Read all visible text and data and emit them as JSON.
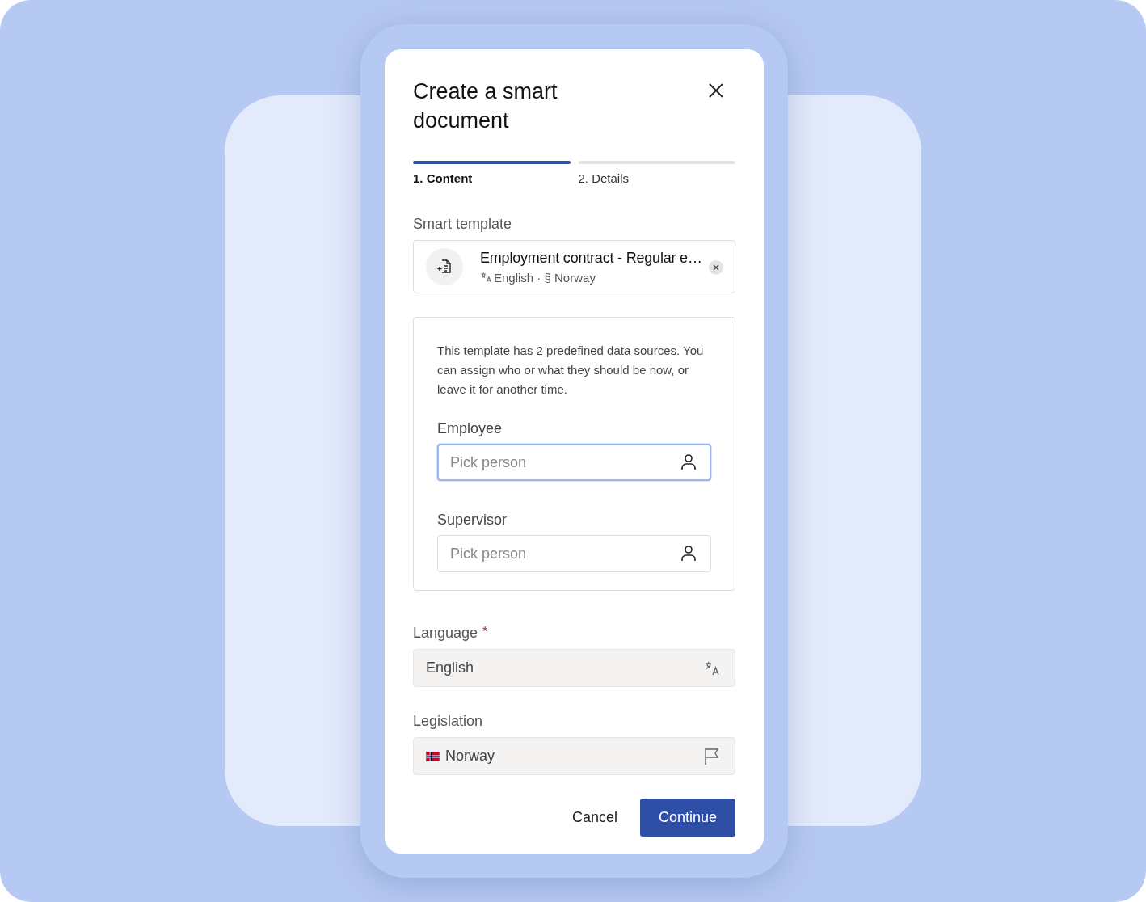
{
  "dialog": {
    "title": "Create a smart document"
  },
  "steps": [
    {
      "label": "1. Content",
      "selected": true
    },
    {
      "label": "2. Details",
      "selected": false
    }
  ],
  "smart_template": {
    "label": "Smart template",
    "name": "Employment contract - Regular e…",
    "meta": "English · § Norway"
  },
  "data_sources": {
    "description": "This template has 2 predefined data sources. You can assign who or what they should be now, or leave it for another time.",
    "fields": [
      {
        "label": "Employee",
        "placeholder": "Pick person",
        "focused": true
      },
      {
        "label": "Supervisor",
        "placeholder": "Pick person",
        "focused": false
      }
    ]
  },
  "language": {
    "label": "Language",
    "required_mark": "*",
    "value": "English",
    "disabled": true
  },
  "legislation": {
    "label": "Legislation",
    "value": "Norway",
    "disabled": true
  },
  "buttons": {
    "cancel": "Cancel",
    "continue": "Continue"
  }
}
